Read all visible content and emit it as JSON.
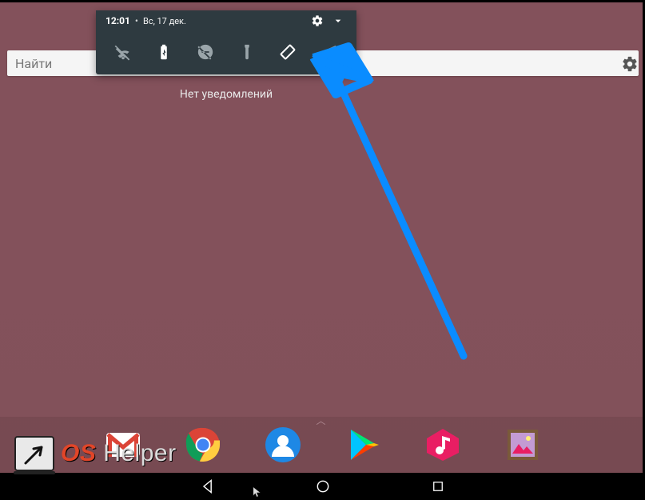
{
  "notification_panel": {
    "time": "12:01",
    "separator": "•",
    "date": "Вс, 17 дек.",
    "icons": {
      "settings": "gear",
      "expand": "chevron-down"
    },
    "quick_settings": [
      {
        "name": "wifi-off-icon",
        "active": false
      },
      {
        "name": "battery-charging-icon",
        "active": true
      },
      {
        "name": "dnd-off-icon",
        "active": false
      },
      {
        "name": "flashlight-icon",
        "active": false
      },
      {
        "name": "auto-rotate-icon",
        "active": true
      },
      {
        "name": "location-icon",
        "active": false
      }
    ]
  },
  "no_notifications_text": "Нет уведомлений",
  "search": {
    "placeholder": "Найти"
  },
  "dock_apps": [
    {
      "name": "gmail-app"
    },
    {
      "name": "chrome-app"
    },
    {
      "name": "contacts-app"
    },
    {
      "name": "play-store-app"
    },
    {
      "name": "music-app"
    },
    {
      "name": "gallery-app"
    }
  ],
  "nav": {
    "back": "back",
    "home": "home",
    "recent": "recent"
  },
  "watermark": {
    "brand_prefix": "OS",
    "brand_suffix": " Helper"
  },
  "colors": {
    "panel_bg": "#2e3a40",
    "arrow": "#0a8cff",
    "wallpaper": "#83515b",
    "brand_red": "#e24528"
  }
}
